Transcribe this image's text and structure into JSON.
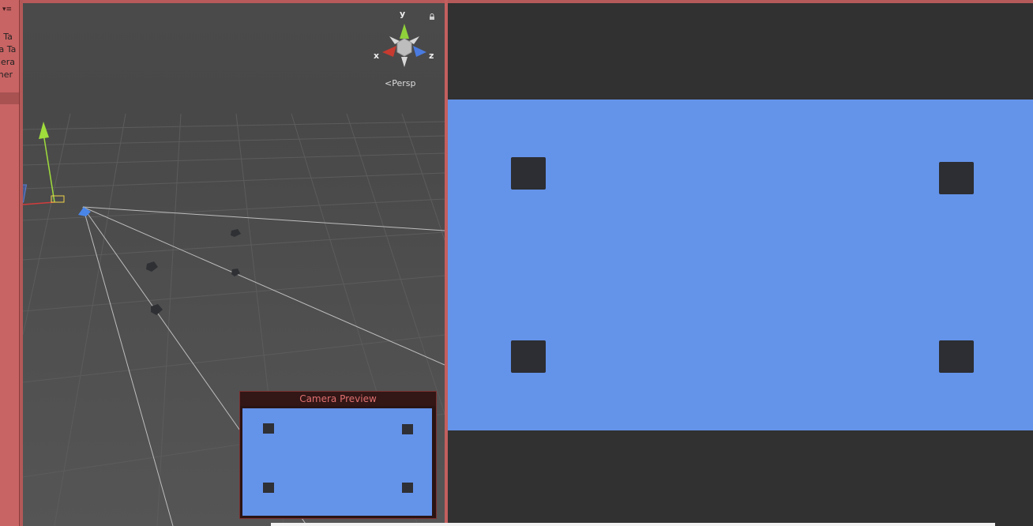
{
  "hierarchy": {
    "menu_icon": "▾≡",
    "items": [
      "a Ta",
      "ra Ta",
      "nera",
      "mer"
    ]
  },
  "scene": {
    "gizmo": {
      "y_label": "y",
      "x_label": "x",
      "z_label": "z"
    },
    "projection_label": "Persp",
    "icons": [
      "axis-gizmo-icon",
      "lock-icon",
      "camera-icon",
      "transform-handle-icon"
    ]
  },
  "camera_preview": {
    "title": "Camera Preview"
  },
  "colors": {
    "sky": "#6493ea",
    "cube": "#2c2e33",
    "game_background": "#313131",
    "editor_tint": "#c86464"
  }
}
